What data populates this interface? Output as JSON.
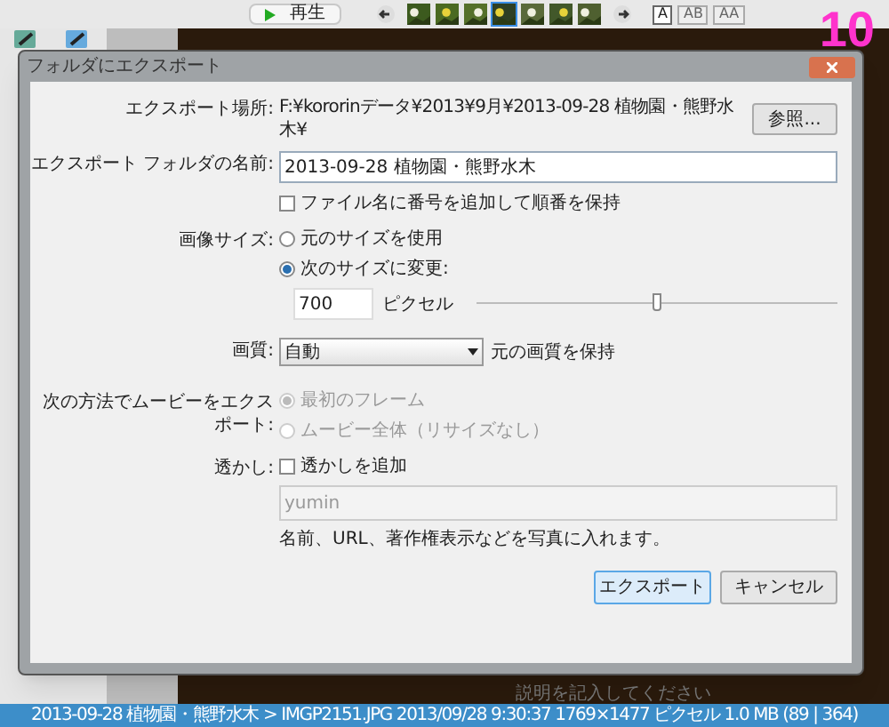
{
  "app_toolbar": {
    "play_button": "再生",
    "thumbnails": [
      {
        "selected": false
      },
      {
        "selected": false
      },
      {
        "selected": false
      },
      {
        "selected": true
      },
      {
        "selected": false
      },
      {
        "selected": false
      },
      {
        "selected": false
      }
    ],
    "layout_buttons": [
      {
        "label": "A",
        "selected": true
      },
      {
        "label": "AB",
        "selected": false
      },
      {
        "label": "AA",
        "selected": false
      }
    ]
  },
  "step_badge": "10",
  "dialog": {
    "title": "フォルダにエクスポート",
    "location": {
      "label": "エクスポート場所:",
      "value": "F:¥kororinデータ¥2013¥9月¥2013-09-28 植物園・熊野水木¥",
      "button": "参照..."
    },
    "folder_name": {
      "label": "エクスポート フォルダの名前:",
      "value": "2013-09-28 植物園・熊野水木"
    },
    "keep_order": {
      "label": "ファイル名に番号を追加して順番を保持",
      "checked": false
    },
    "image_size": {
      "label": "画像サイズ:",
      "options": [
        {
          "label": "元のサイズを使用",
          "selected": false
        },
        {
          "label": "次のサイズに変更:",
          "selected": true
        }
      ],
      "pixels": "700",
      "unit": "ピクセル",
      "level": 0.5
    },
    "quality": {
      "label": "画質:",
      "value": "自動",
      "note": "元の画質を保持"
    },
    "movie": {
      "label": "次の方法でムービーをエクスポート:",
      "disabled": true,
      "options": [
        {
          "label": "最初のフレーム",
          "selected": true
        },
        {
          "label": "ムービー全体（リサイズなし）",
          "selected": false
        }
      ]
    },
    "watermark": {
      "label": "透かし:",
      "checkbox": {
        "label": "透かしを追加",
        "checked": false
      },
      "value": "yumin",
      "hint": "名前、URL、著作権表示などを写真に入れます。"
    },
    "buttons": [
      {
        "label": "エクスポート",
        "kind": "primary"
      },
      {
        "label": "キャンセル",
        "kind": "normal"
      }
    ]
  },
  "description_hint": "説明を記入してください",
  "status_bar": "2013-09-28 植物園・熊野水木 > IMGP2151.JPG 2013/09/28 9:30:37 1769×1477 ピクセル 1.0 MB (89 | 364)"
}
